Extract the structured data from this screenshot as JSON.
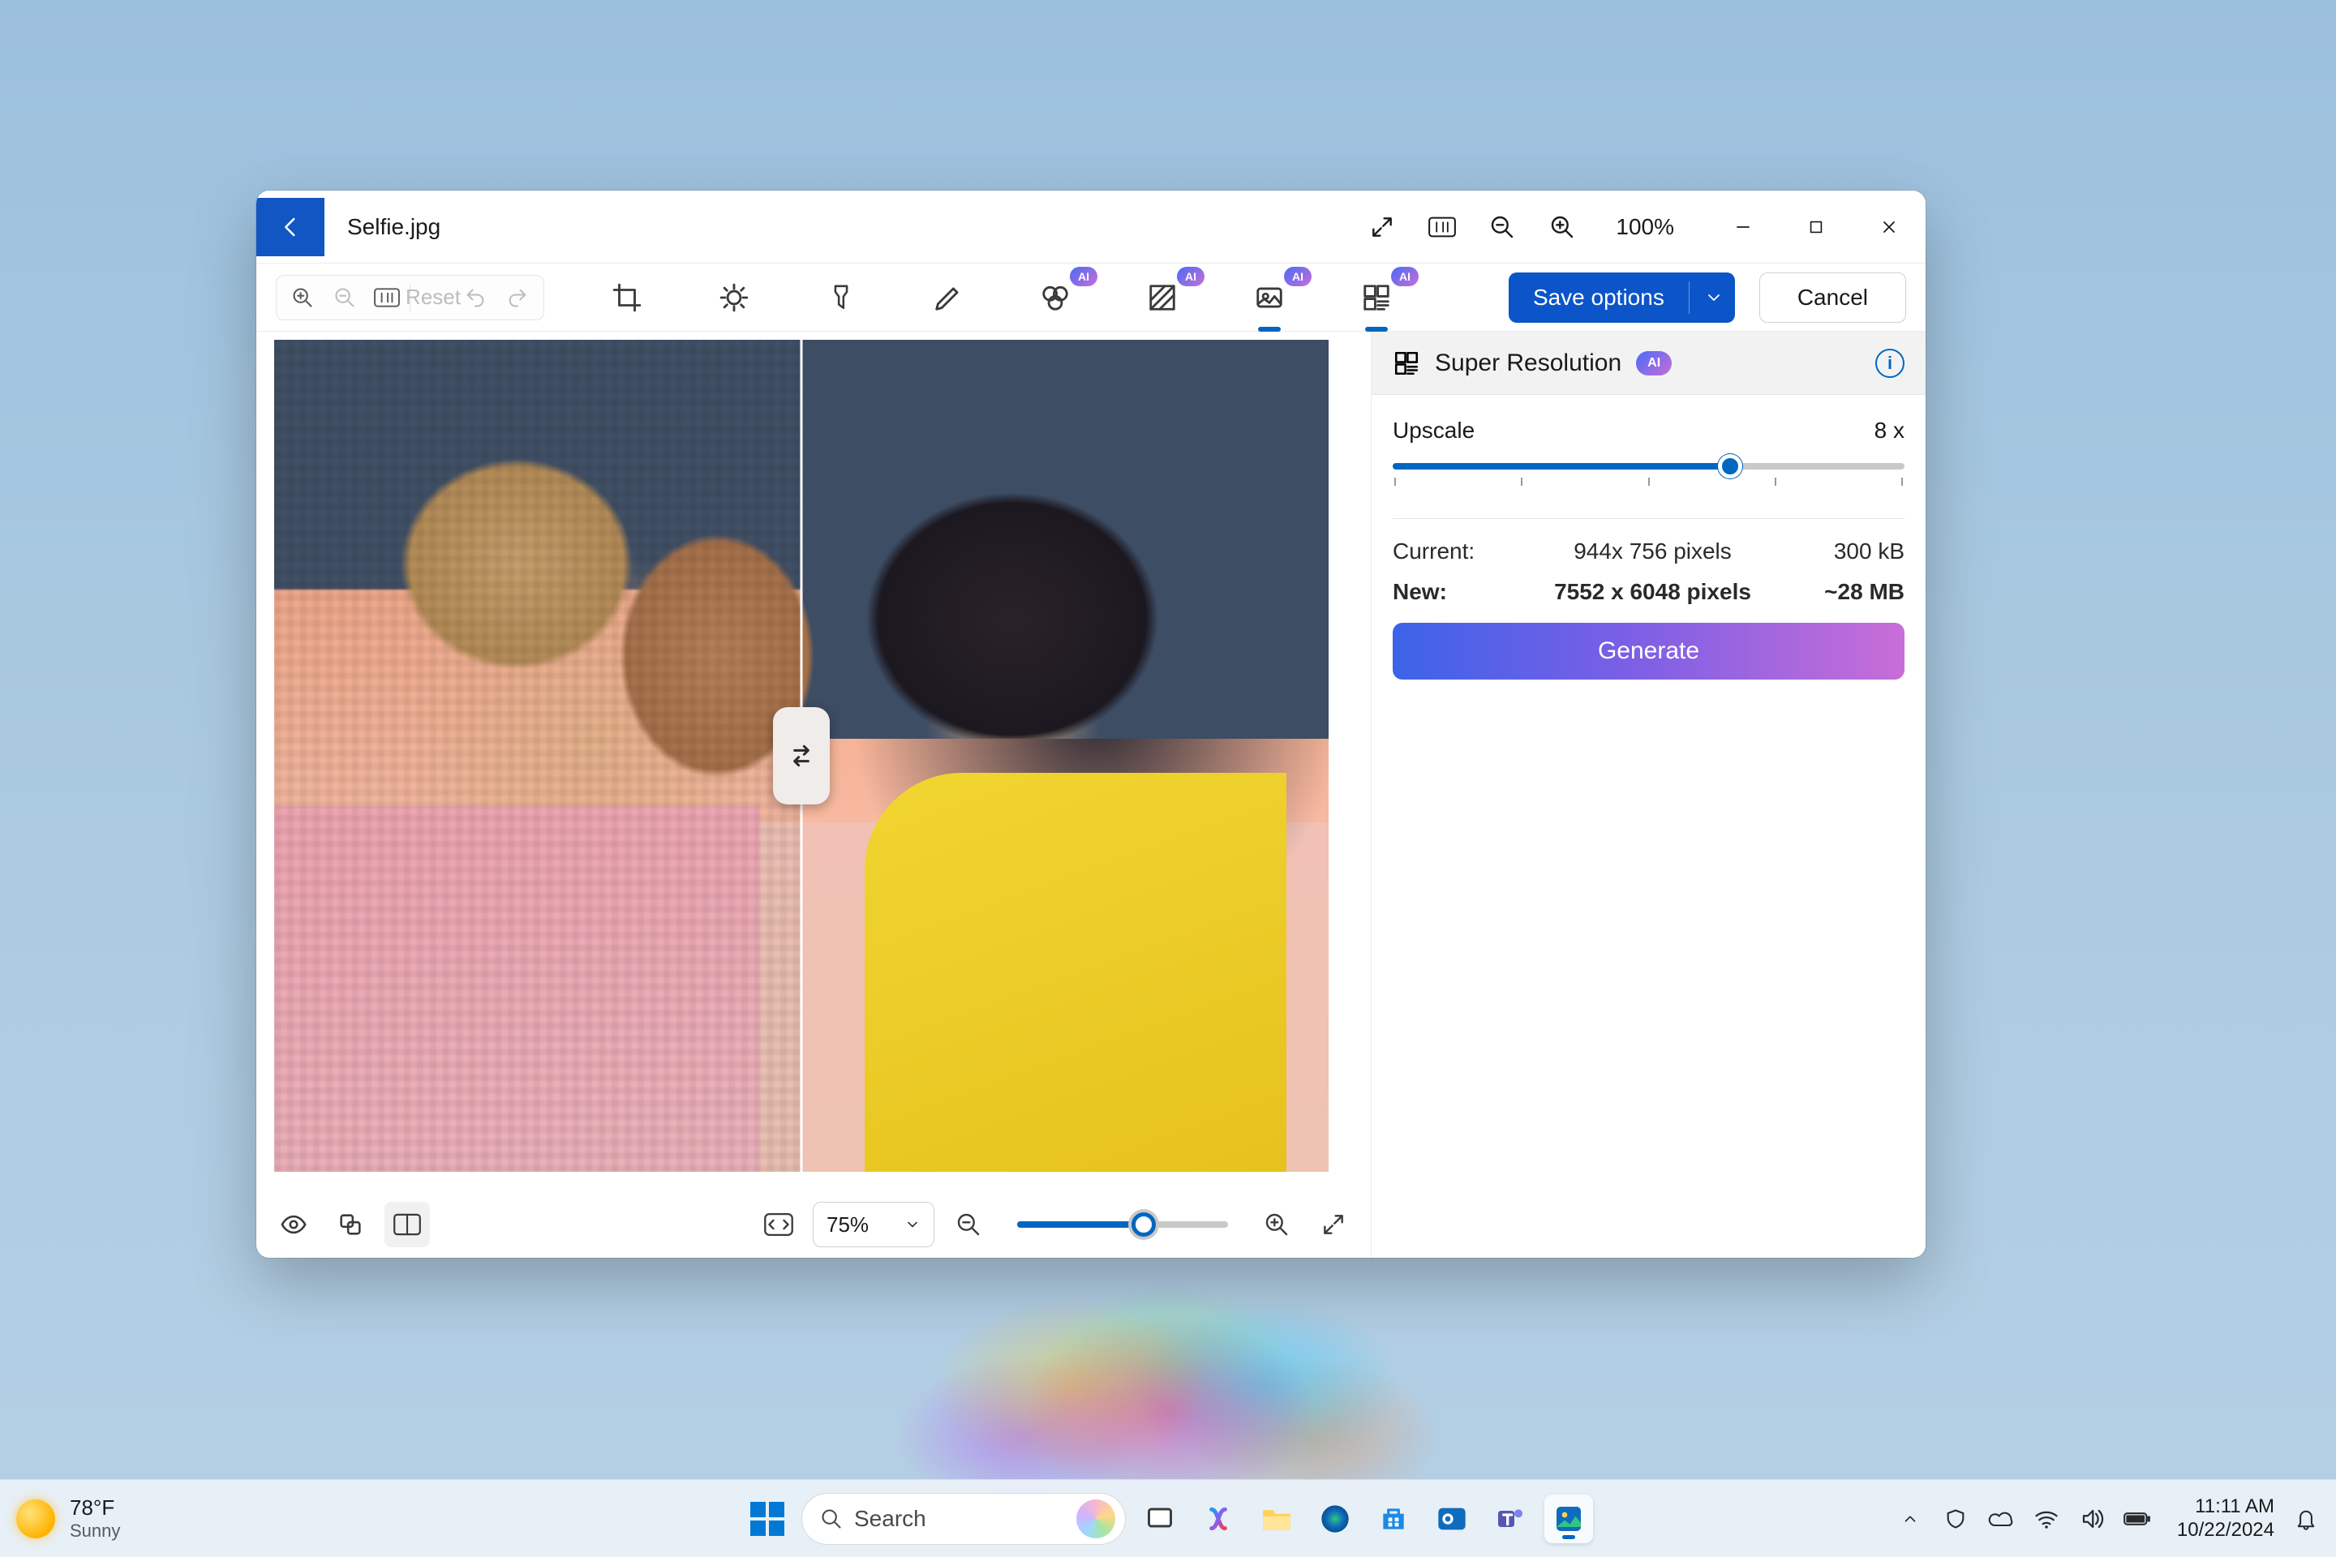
{
  "titlebar": {
    "filename": "Selfie.jpg",
    "zoom_percent": "100%"
  },
  "toolbar": {
    "reset_label": "Reset",
    "save_label": "Save options",
    "cancel_label": "Cancel",
    "ai_badge": "AI"
  },
  "panel": {
    "title": "Super Resolution",
    "ai_badge": "AI",
    "upscale_label": "Upscale",
    "upscale_value": "8 x",
    "current_label": "Current:",
    "current_dims": "944x 756 pixels",
    "current_size": "300 kB",
    "new_label": "New:",
    "new_dims": "7552 x 6048 pixels",
    "new_size": "~28 MB",
    "generate_label": "Generate"
  },
  "canvas_footer": {
    "zoom_select": "75%"
  },
  "taskbar": {
    "weather_temp": "78°F",
    "weather_cond": "Sunny",
    "search_placeholder": "Search",
    "time": "11:11 AM",
    "date": "10/22/2024"
  }
}
